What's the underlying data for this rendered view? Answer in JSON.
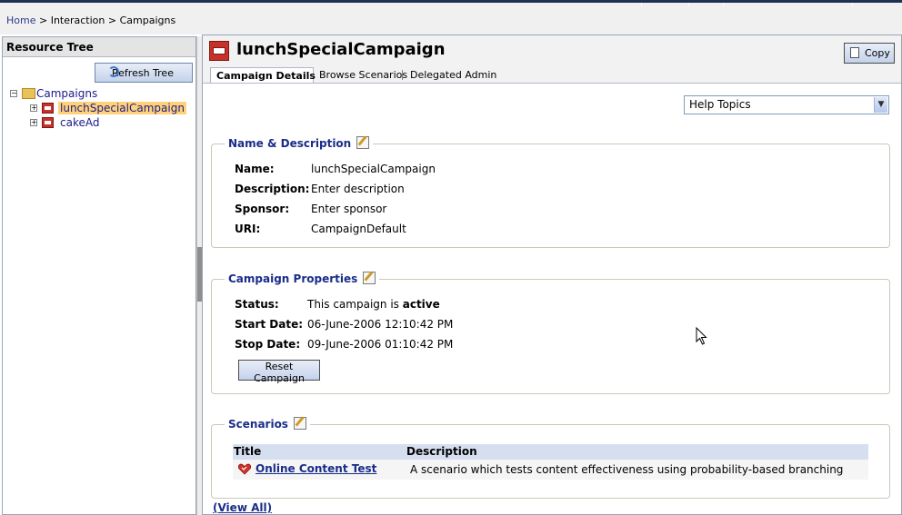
{
  "breadcrumb": {
    "home": "Home",
    "sep1": ">",
    "interaction": "Interaction",
    "sep2": ">",
    "campaigns": "Campaigns"
  },
  "left_panel": {
    "title": "Resource Tree",
    "refresh_label": "Refresh Tree",
    "tree": {
      "root": "Campaigns",
      "items": [
        "lunchSpecialCampaign",
        "cakeAd"
      ]
    }
  },
  "main": {
    "title": "lunchSpecialCampaign",
    "copy_label": "Copy",
    "tabs": [
      "Campaign Details",
      "Browse Scenarios",
      "Delegated Admin"
    ],
    "help_select": "Help Topics",
    "name_section": {
      "title": "Name & Description",
      "fields": [
        {
          "label": "Name:",
          "value": "lunchSpecialCampaign"
        },
        {
          "label": "Description:",
          "value": "Enter description"
        },
        {
          "label": "Sponsor:",
          "value": "Enter sponsor"
        },
        {
          "label": "URI:",
          "value": "CampaignDefault"
        }
      ]
    },
    "props_section": {
      "title": "Campaign Properties",
      "status_label": "Status:",
      "status_prefix": "This campaign is",
      "status_value": "active",
      "start_label": "Start Date:",
      "start_value": "06-June-2006 12:10:42 PM",
      "stop_label": "Stop Date:",
      "stop_value": "09-June-2006 01:10:42 PM",
      "reset_label": "Reset Campaign"
    },
    "scenarios_section": {
      "title": "Scenarios",
      "col_title": "Title",
      "col_desc": "Description",
      "rows": [
        {
          "title": "Online Content Test",
          "description": "A scenario which tests content effectiveness using probability-based branching"
        }
      ],
      "view_all": "(View All)"
    }
  },
  "colors": {
    "link": "#1a2d8a",
    "selection": "#ffd27a",
    "table_header": "#d6dfef",
    "group_border": "#c9c9b8"
  }
}
